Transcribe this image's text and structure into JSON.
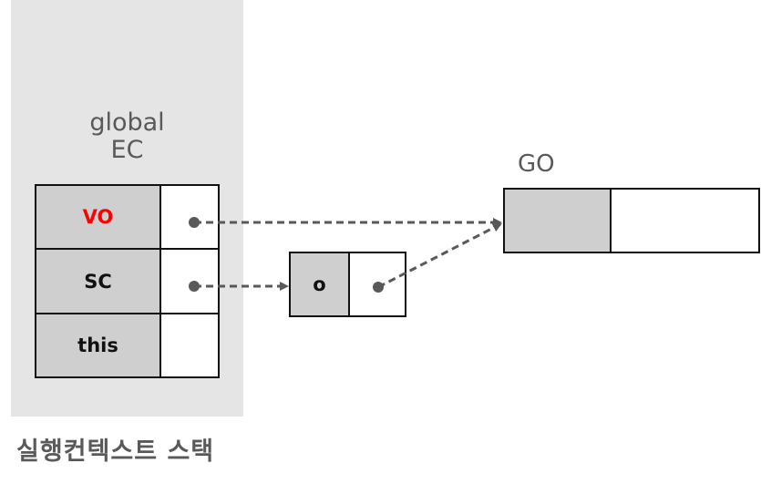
{
  "execution_context_stack": {
    "label": "실행컨텍스트 스택",
    "context": {
      "title_line1": "global",
      "title_line2": "EC",
      "rows": [
        {
          "key": "VO",
          "key_color": "#ff0000",
          "has_pointer": true,
          "points_to": "GO"
        },
        {
          "key": "SC",
          "key_color": "#111111",
          "has_pointer": true,
          "points_to": "o"
        },
        {
          "key": "this",
          "key_color": "#111111",
          "has_pointer": false
        }
      ]
    }
  },
  "scope_chain_object": {
    "key": "o",
    "has_pointer": true,
    "points_to": "GO"
  },
  "global_object": {
    "label": "GO"
  },
  "colors": {
    "panel": "#e5e5e5",
    "key_cell": "#d0cfcf",
    "arrow": "#595959",
    "highlight": "#ff0000"
  }
}
